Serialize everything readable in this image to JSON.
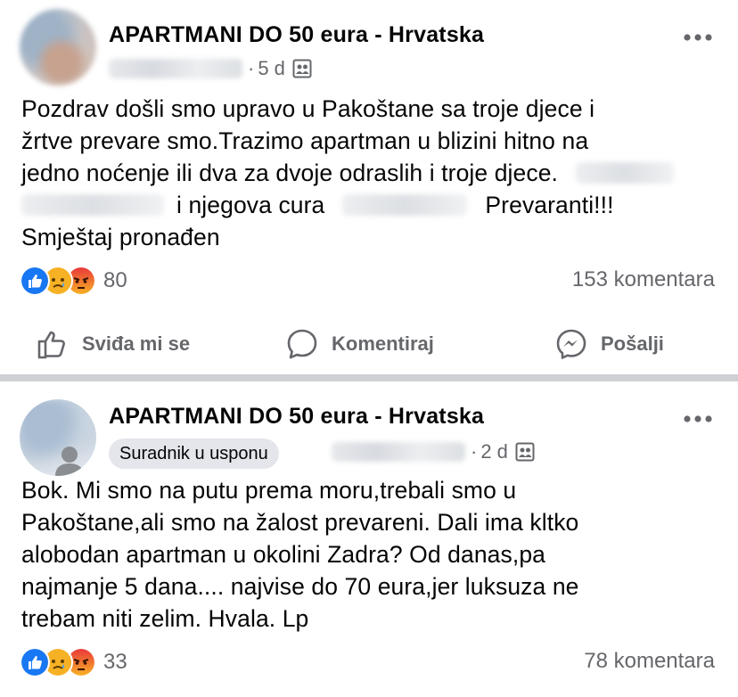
{
  "posts": [
    {
      "group_name": "APARTMANI DO 50 eura - Hrvatska",
      "time": "5 d",
      "badge": "",
      "lines": [
        "Pozdrav došli smo upravo u Pakoštane sa troje djece i",
        "žrtve prevare smo.Trazimo apartman u blizini hitno na",
        "jedno noćenje ili dva za dvoje odraslih i troje djece."
      ],
      "line4_a": "i njegova cura",
      "line4_b": "Prevaranti!!!",
      "line5": "Smještaj pronađen",
      "reaction_count": "80",
      "comment_count": "153 komentara",
      "actions": {
        "like": "Sviđa mi se",
        "comment": "Komentiraj",
        "share": "Pošalji"
      }
    },
    {
      "group_name": "APARTMANI DO 50 eura - Hrvatska",
      "time": "2 d",
      "badge": "Suradnik u usponu",
      "lines": [
        "Bok. Mi smo na putu prema moru,trebali smo u",
        "Pakoštane,ali smo na žalost prevareni. Dali ima kltko",
        "alobodan apartman u okolini Zadra? Od danas,pa",
        "najmanje 5 dana.... najvise do 70 eura,jer luksuza ne",
        "trebam niti zelim. Hvala. Lp"
      ],
      "reaction_count": "33",
      "comment_count": "78 komentara"
    }
  ],
  "meta_separator": "·",
  "colors": {
    "like_blue": "#1877f2",
    "sad_yellow": "#f7b125",
    "angry_red": "#e9710f",
    "secondary_text": "#65676b",
    "divider": "#ced0d4"
  },
  "icons": [
    "more-icon",
    "group-icon",
    "like-reaction-icon",
    "sad-reaction-icon",
    "angry-reaction-icon",
    "thumbs-up-icon",
    "comment-icon",
    "messenger-icon",
    "person-icon"
  ]
}
